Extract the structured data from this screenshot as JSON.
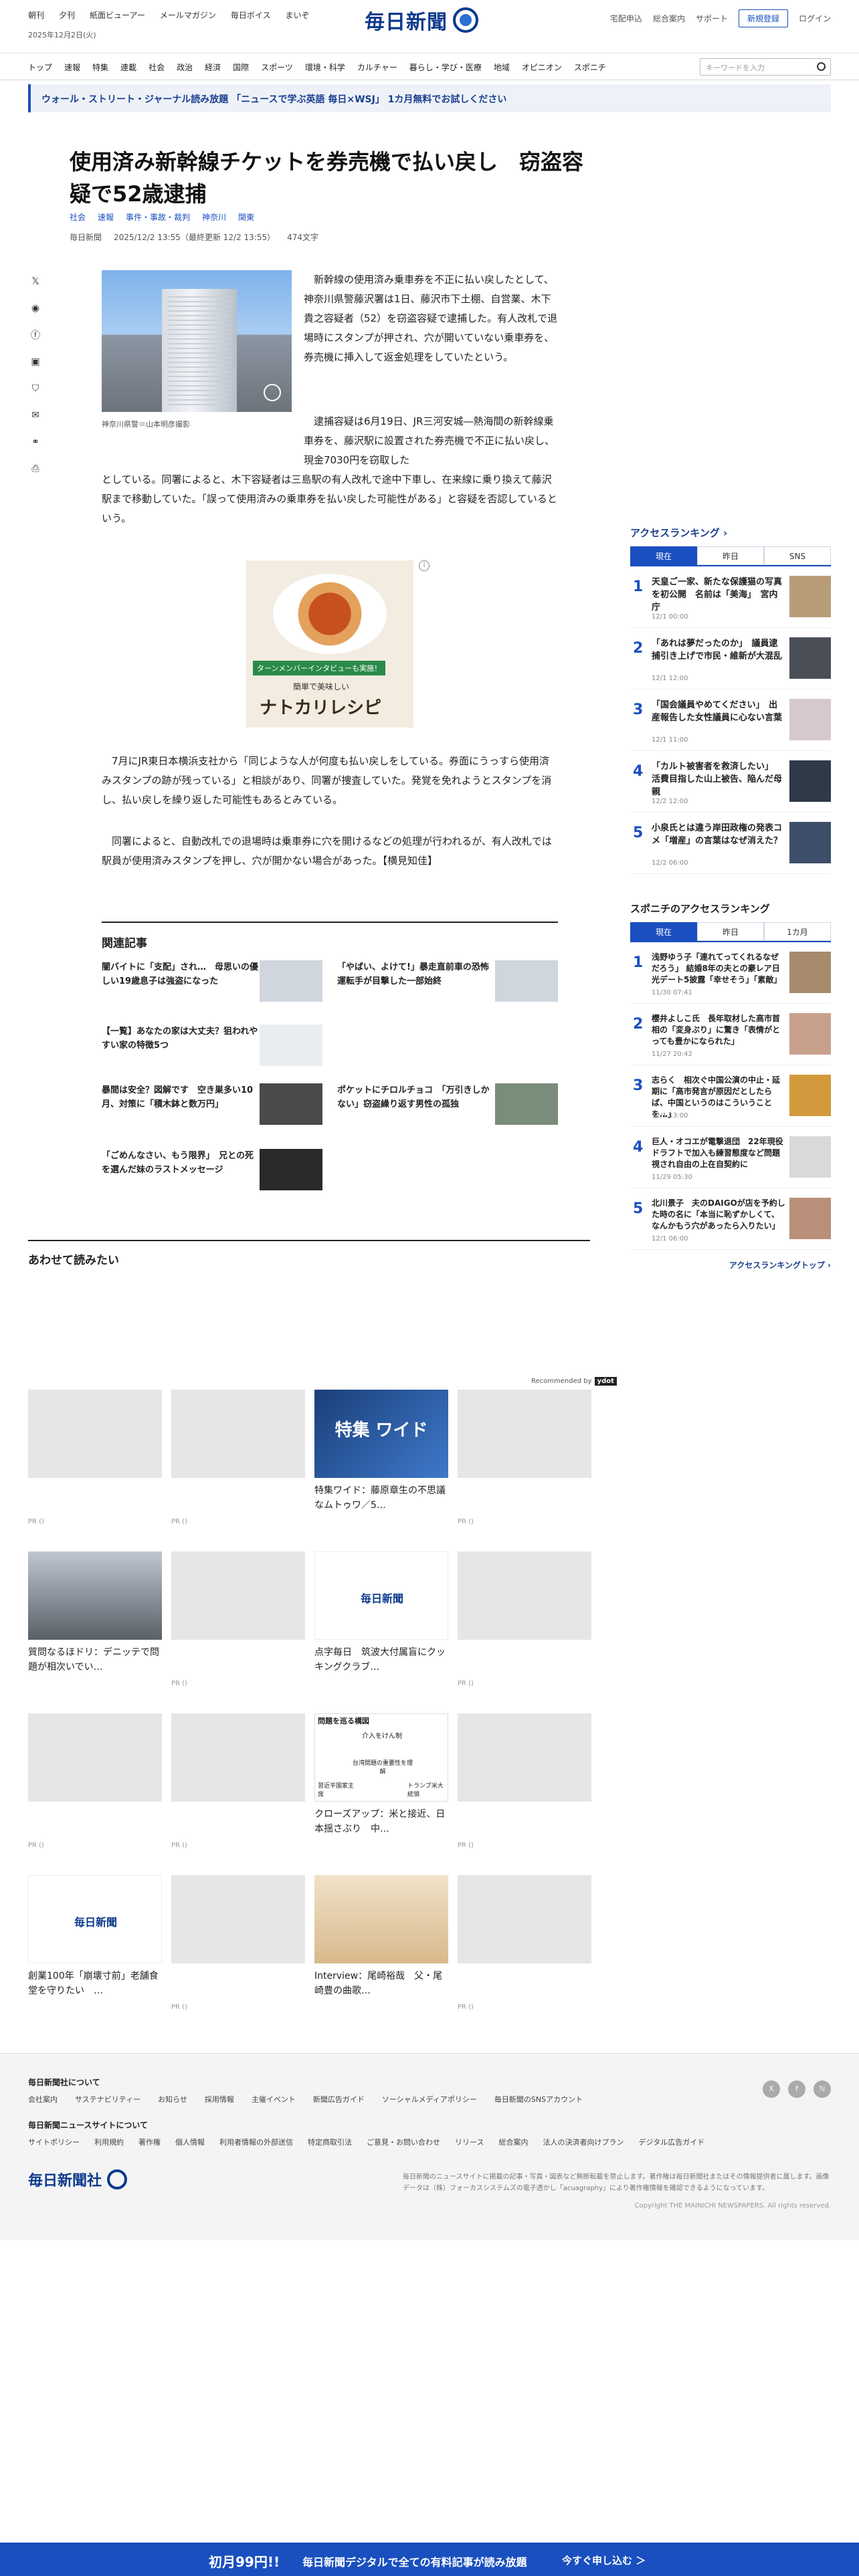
{
  "header": {
    "top_links": [
      "朝刊",
      "夕刊",
      "紙面ビューアー",
      "メールマガジン",
      "毎日ボイス",
      "まいぞ"
    ],
    "date": "2025年12月2日(火)",
    "logo": "毎日新聞",
    "right_links": [
      "宅配申込",
      "総合案内",
      "サポート"
    ],
    "register": "新規登録",
    "login": "ログイン"
  },
  "nav": {
    "items": [
      "トップ",
      "速報",
      "特集",
      "連載",
      "社会",
      "政治",
      "経済",
      "国際",
      "スポーツ",
      "環境・科学",
      "カルチャー",
      "暮らし・学び・医療",
      "地域",
      "オピニオン",
      "スポニチ"
    ],
    "search_placeholder": "キーワードを入力"
  },
  "promo": "ウォール・ストリート・ジャーナル読み放題 「ニュースで学ぶ英語 毎日×WSJ」 1カ月無料でお試しください",
  "article": {
    "title": "使用済み新幹線チケットを券売機で払い戻し　窃盗容疑で52歳逮捕",
    "tags": [
      "社会",
      "速報",
      "事件・事故・裁判",
      "神奈川",
      "関東"
    ],
    "meta": [
      "毎日新聞",
      "2025/12/2 13:55（最終更新 12/2 13:55）",
      "474文字"
    ],
    "caption": "神奈川県警＝山本明彦撮影",
    "p1": "新幹線の使用済み乗車券を不正に払い戻したとして、神奈川県警藤沢署は1日、藤沢市下土棚、自営業、木下貴之容疑者（52）を窃盗容疑で逮捕した。有人改札で退場時にスタンプが押され、穴が開いていない乗車券を、券売機に挿入して返金処理をしていたという。",
    "p2a": "逮捕容疑は6月19日、JR三河安城―熱海間の新幹線乗車券を、藤沢駅に設置された券売機で不正に払い戻し、現金7030円を窃取した",
    "p2b": "としている。同署によると、木下容疑者は三島駅の有人改札で途中下車し、在来線に乗り換えて藤沢駅まで移動していた。「誤って使用済みの乗車券を払い戻した可能性がある」と容疑を否認しているという。",
    "p3": "7月にJR東日本横浜支社から「同じような人が何度も払い戻しをしている。券面にうっすら使用済みスタンプの跡が残っている」と相談があり、同署が捜査していた。発覚を免れようとスタンプを消し、払い戻しを繰り返した可能性もあるとみている。",
    "p4": "同署によると、自動改札での退場時は乗車券に穴を開けるなどの処理が行われるが、有人改札では駅員が使用済みスタンプを押し、穴が開かない場合があった。【横見知佳】"
  },
  "ad": {
    "badge": "ターンメンバーインタビューも実施！",
    "sub": "簡単で美味しい",
    "headline": "ナトカリレシピ"
  },
  "related": {
    "heading": "関連記事",
    "items": [
      "闇バイトに「支配」され…　母思いの優しい19歳息子は強盗になった",
      "「やばい、よけて!」暴走直前車の恐怖　運転手が目撃した一部始終",
      "【一覧】あなたの家は大丈夫？狙われやすい家の特徴5つ",
      "暴間は安全？図解です　空き巣多い10月、対策に「積木鉢と数万円」",
      "ポケットにチロルチョコ　「万引きしかない」窃盗繰り返す男性の孤独",
      "「ごめんなさい、もう限界」　兄との死を選んだ妹のラストメッセージ"
    ]
  },
  "also_read": {
    "heading": "あわせて読みたい",
    "recommended_by": "Recommended by",
    "rec_logo": "ydot",
    "cards": [
      {
        "title": "",
        "pr": "PR ()"
      },
      {
        "title": "",
        "pr": "PR ()"
      },
      {
        "title": "特集ワイド：藤原章生の不思議なムトゥワ／5…",
        "pr": ""
      },
      {
        "title": "",
        "pr": "PR ()"
      },
      {
        "title": "質問なるほドリ：デニッテで問題が相次いでい…",
        "pr": ""
      },
      {
        "title": "",
        "pr": "PR ()"
      },
      {
        "title": "点字毎日　筑波大付属盲にクッキングクラブ…",
        "pr": ""
      },
      {
        "title": "",
        "pr": "PR ()"
      },
      {
        "title": "",
        "pr": "PR ()"
      },
      {
        "title": "",
        "pr": "PR ()"
      },
      {
        "title": "クローズアップ：米と接近、日本揺さぶり　中…",
        "pr": ""
      },
      {
        "title": "",
        "pr": "PR ()"
      },
      {
        "title": "創業100年「崩壊寸前」老舗食堂を守りたい　…",
        "pr": ""
      },
      {
        "title": "",
        "pr": "PR ()"
      },
      {
        "title": "Interview：尾崎裕哉　父・尾崎豊の曲歌…",
        "pr": ""
      },
      {
        "title": "",
        "pr": "PR ()"
      }
    ],
    "feature_label": "特集 ワイド",
    "issue_label": "問題を巡る構図",
    "issue_sub": "介入をけん制",
    "issue_left": "習近平国家主席",
    "issue_mid": "台湾問題の重要性を理解",
    "issue_right": "トランプ米大統領"
  },
  "ranking": {
    "heading": "アクセスランキング",
    "tabs": [
      "現在",
      "昨日",
      "SNS"
    ],
    "items": [
      {
        "n": "1",
        "title": "天皇ご一家、新たな保護猫の写真を初公開　名前は「美海」　宮内庁",
        "date": "12/1 00:00"
      },
      {
        "n": "2",
        "title": "「あれは夢だったのか」　議員逮捕引き上げで市民・維新が大混乱",
        "date": "12/1 12:00"
      },
      {
        "n": "3",
        "title": "「国会議員やめてください」　出産報告した女性議員に心ない言葉",
        "date": "12/1 11:00"
      },
      {
        "n": "4",
        "title": "「カルト被害者を救済したい」　活費目指した山上被告、陥んだ母親",
        "date": "12/2 12:00"
      },
      {
        "n": "5",
        "title": "小泉氏とは違う岸田政権の発表コメ「増産」の言葉はなぜ消えた？",
        "date": "12/2 06:00"
      }
    ],
    "more": ""
  },
  "sponichi": {
    "heading": "スポニチのアクセスランキング",
    "tabs": [
      "現在",
      "昨日",
      "1カ月"
    ],
    "items": [
      {
        "n": "1",
        "title": "浅野ゆう子「連れてってくれるなぜだろう」 結婚8年の夫との豪レア日光デート5披露「幸せそう」「素敵」",
        "date": "11/30 07:41"
      },
      {
        "n": "2",
        "title": "櫻井よしこ氏　長年取材した高市首相の「変身ぶり」に驚き「表情がとっても豊かになられた」",
        "date": "11/27 20:42"
      },
      {
        "n": "3",
        "title": "志らく　相次ぐ中国公演の中止・延期に「高市発言が原因だとしたらば、中国というのはこういうことを…」",
        "date": "12/1 13:00"
      },
      {
        "n": "4",
        "title": "巨人・オコエが電撃退団　22年現役ドラフトで加入も練習態度など問題視され自由の上在自契約に",
        "date": "11/29 05:30"
      },
      {
        "n": "5",
        "title": "北川景子　夫のDAIGOが店を予約した時の名に「本当に恥ずかしくて、なんかもう穴があったら入りたい」",
        "date": "12/1 06:00"
      }
    ],
    "more": "アクセスランキングトップ"
  },
  "footer": {
    "about_heading": "毎日新聞社について",
    "about_links": [
      "会社案内",
      "サステナビリティー",
      "お知らせ",
      "採用情報",
      "主催イベント",
      "新聞広告ガイド",
      "ソーシャルメディアポリシー",
      "毎日新聞のSNSアカウント"
    ],
    "site_heading": "毎日新聞ニュースサイトについて",
    "site_links": [
      "サイトポリシー",
      "利用規約",
      "著作権",
      "個人情報",
      "利用者情報の外部送信",
      "特定商取引法",
      "ご意見・お問い合わせ",
      "リリース",
      "総合案内",
      "法人の決済者向けプラン",
      "デジタル広告ガイド"
    ],
    "social": [
      "X",
      "f",
      "ℕ"
    ],
    "logo": "毎日新聞社",
    "note": "毎日新聞のニュースサイトに掲載の記事・写真・図表など無断転載を禁止します。著作権は毎日新聞社またはその情報提供者に属します。画像データは（株）フォーカスシステムズの電子透かし「acuagraphy」により著作権情報を確認できるようになっています。",
    "copyright": "Copyright THE MAINICHI NEWSPAPERS. All rights reserved."
  },
  "bottom_bar": {
    "price": "初月99円!!",
    "text": "毎日新聞デジタルで全ての有料記事が読み放題",
    "cta": "今すぐ申し込む ＞"
  },
  "colors": {
    "brand": "#0b3a8c",
    "accent": "#1a4fbf"
  }
}
